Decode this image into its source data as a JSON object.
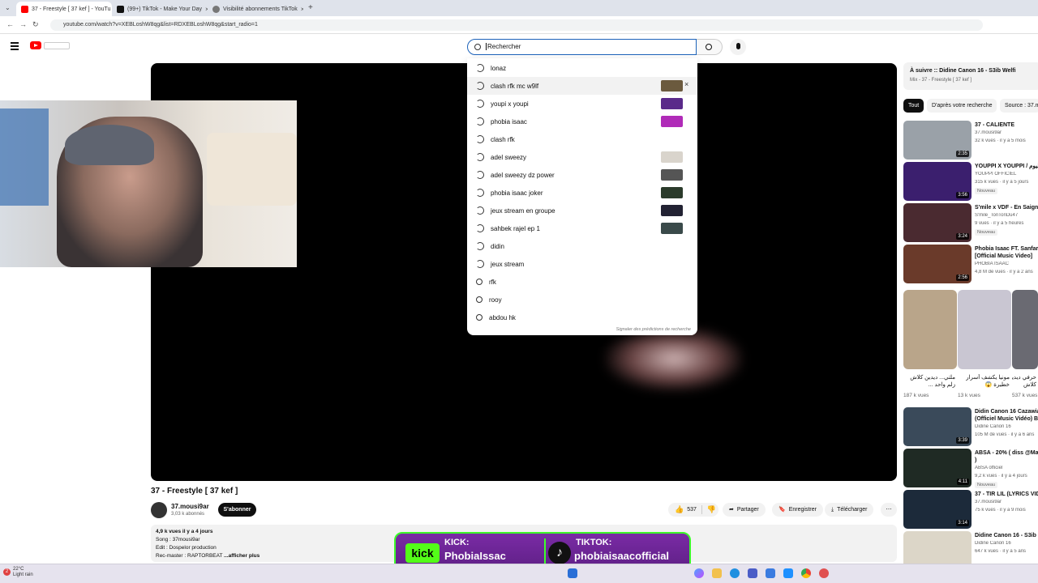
{
  "browser": {
    "tabs": [
      {
        "label": "37 - Freestyle [ 37 kef ] - YouTu",
        "close": "×",
        "favicon_color": "#ff0000"
      },
      {
        "label": "(99+) TikTok - Make Your Day",
        "close": "×",
        "favicon_color": "#111111"
      },
      {
        "label": "Visibilité abonnements TikTok",
        "close": "×",
        "favicon_color": "#777777"
      }
    ],
    "new_tab": "+",
    "url": "youtube.com/watch?v=XEBLoshW8qg&list=RDXEBLoshW8qg&start_radio=1"
  },
  "youtube": {
    "search_placeholder": "Rechercher",
    "suggestions": [
      {
        "text": "lonaz",
        "icon": "history-icon",
        "thumb": ""
      },
      {
        "text": "clash rfk mc w9lf",
        "icon": "history-icon",
        "thumb": "#6b5a3e",
        "remove": "×"
      },
      {
        "text": "youpi x youpi",
        "icon": "history-icon",
        "thumb": "#5a2a8a"
      },
      {
        "text": "phobia isaac",
        "icon": "history-icon",
        "thumb": "#b02bb8"
      },
      {
        "text": "clash rfk",
        "icon": "history-icon",
        "thumb": ""
      },
      {
        "text": "adel sweezy",
        "icon": "history-icon",
        "thumb": "#d9d4cc"
      },
      {
        "text": "adel sweezy dz power",
        "icon": "history-icon",
        "thumb": "#555555"
      },
      {
        "text": "phobia isaac joker",
        "icon": "history-icon",
        "thumb": "#2b3b2b"
      },
      {
        "text": "jeux stream en groupe",
        "icon": "history-icon",
        "thumb": "#222233"
      },
      {
        "text": "sahbek rajel ep 1",
        "icon": "history-icon",
        "thumb": "#3a4a4a"
      },
      {
        "text": "didin",
        "icon": "history-icon",
        "thumb": ""
      },
      {
        "text": "jeux stream",
        "icon": "history-icon",
        "thumb": ""
      },
      {
        "text": "rfk",
        "icon": "search-icon",
        "thumb": ""
      },
      {
        "text": "rooy",
        "icon": "search-icon",
        "thumb": ""
      },
      {
        "text": "abdou hk",
        "icon": "search-icon",
        "thumb": ""
      }
    ],
    "report_link": "Signaler des prédictions de recherche",
    "video": {
      "title": "37 - Freestyle [ 37 kef ]",
      "channel": "37.mousi9ar",
      "subscribers": "3,03 k abonnés",
      "subscribe": "S'abonner",
      "likes": "537",
      "share": "Partager",
      "save": "Enregistrer",
      "download": "Télécharger",
      "more": "⋯",
      "desc_stats": "4,9 k vues  il y a 4 jours",
      "desc_lines": [
        "Song : 37mousi9ar",
        "Edit : Dospelor production",
        "Rec-master : RAPTORBEAT "
      ],
      "desc_more": "...afficher plus"
    },
    "sidebar": {
      "mix_title": "À suivre :: Didine Canon 16 - S3ib Welfi",
      "mix_sub": "Mix - 37 - Freestyle [ 37 kef ]",
      "chips": [
        "Tout",
        "D'après votre recherche",
        "Source : 37.m"
      ],
      "videos": [
        {
          "title": "37 - CALIENTE",
          "channel": "37.mousi9ar",
          "meta": "32 k vues · il y a 5 mois",
          "duration": "2:35",
          "badge": "",
          "thumb": "#9aa1a8"
        },
        {
          "title": "YOUPPI X YOUPPI / اليوم",
          "channel": "YOUPPI OFFICIEL",
          "meta": "315 k vues · il y a 5 jours",
          "duration": "3:56",
          "badge": "Nouveau",
          "thumb": "#3b1f6e"
        },
        {
          "title": "S'mile x VDF - En Saignant",
          "channel": "S'mile_TonTonDu47",
          "meta": "9 vues · il y a 5 heures",
          "duration": "3:24",
          "badge": "Nouveau",
          "thumb": "#4a2a30"
        },
        {
          "title": "Phobia Isaac FT. Sanfara",
          "title2": "[Official Music Video]",
          "channel": "PHOBIA ISAAC",
          "meta": "4,8 M de vues · il y a 2 ans",
          "duration": "2:56",
          "badge": "",
          "thumb": "#6a3a2a"
        },
        {
          "title": "Didin Canon 16 Cazawia",
          "title2": "(Officiel Music Vidéo) Be",
          "channel": "Didine Canon 16",
          "meta": "105 M de vues · il y a 6 ans",
          "duration": "3:39",
          "badge": "",
          "thumb": "#3a4a5a"
        },
        {
          "title": "ABSA - 20% ( diss @Mass",
          "title2": ")",
          "channel": "ABSA officiel",
          "meta": "9,2 k vues · il y a 4 jours",
          "duration": "4:11",
          "badge": "Nouveau",
          "thumb": "#1f2a24"
        },
        {
          "title": "37 - TIR LIL (LYRICS VIDE",
          "channel": "37.mousi9ar",
          "meta": "75 k vues · il y a 9 mois",
          "duration": "3:14",
          "badge": "",
          "thumb": "#1c2a3a"
        },
        {
          "title": "Didine Canon 16 - S3ib",
          "channel": "Didine Canon 16",
          "meta": "647 k vues · il y a 5 ans",
          "duration": "",
          "badge": "",
          "thumb": "#dcd6c8"
        }
      ],
      "shorts": [
        {
          "title": "ملتي... ديدين كلاش",
          "title2": "زلم واحد ...",
          "views": "187 k vues",
          "thumb": "#b9a58a"
        },
        {
          "title": "مونيا يكشف أسرار",
          "title2": "خطيرة 😱",
          "views": "13 k vues",
          "thumb": "#c9c6d2"
        },
        {
          "title": "حرفي ديدين",
          "title2": "كلاش",
          "views": "537 k vues",
          "thumb": "#6a6a72"
        }
      ]
    }
  },
  "overlay": {
    "kick_label": "KICK:",
    "kick_name": "PhobiaIssac",
    "kick_logo": "kick",
    "tiktok_label": "TIKTOK:",
    "tiktok_name": "phobiaisaacofficial"
  },
  "taskbar": {
    "weather_temp": "22°C",
    "weather_desc": "Light rain",
    "badge": "2"
  },
  "colors": {
    "youtube_red": "#ff0000",
    "kick_green": "#53fc18",
    "banner_purple": "#6a2596",
    "search_focus": "#1c62b9"
  }
}
